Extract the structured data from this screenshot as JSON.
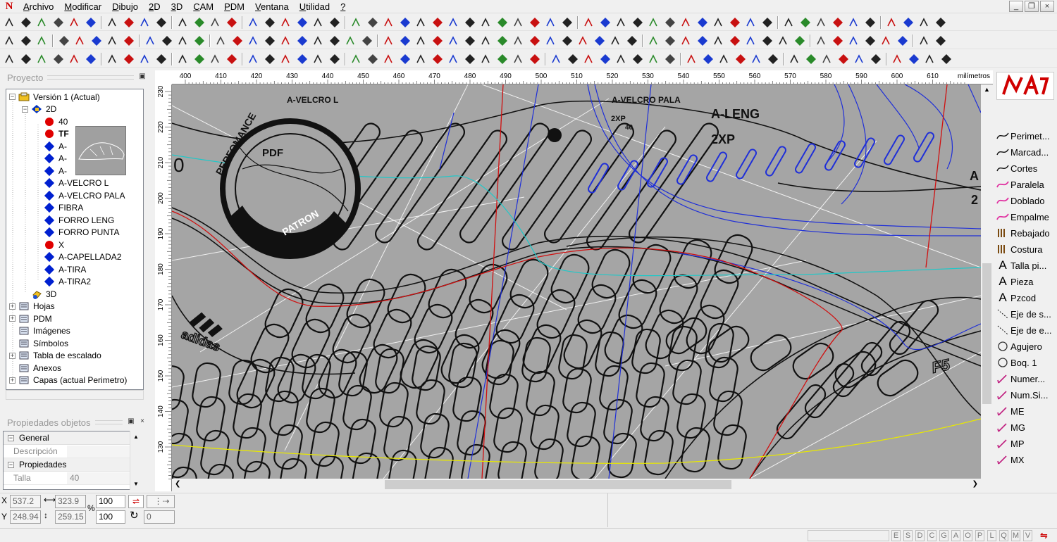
{
  "menu": [
    {
      "label": "Archivo",
      "first": "A",
      "rest": "rchivo"
    },
    {
      "label": "Modificar",
      "first": "M",
      "rest": "odificar"
    },
    {
      "label": "Dibujo",
      "first": "D",
      "rest": "ibujo"
    },
    {
      "label": "2D",
      "first": "2",
      "rest": "D"
    },
    {
      "label": "3D",
      "first": "3",
      "rest": "D"
    },
    {
      "label": "CAM",
      "first": "C",
      "rest": "AM"
    },
    {
      "label": "PDM",
      "first": "P",
      "rest": "DM"
    },
    {
      "label": "Ventana",
      "first": "V",
      "rest": "entana"
    },
    {
      "label": "Utilidad",
      "first": "U",
      "rest": "tilidad"
    },
    {
      "label": "?",
      "first": "?",
      "rest": ""
    }
  ],
  "project_panel": {
    "title": "Proyecto",
    "tree": [
      {
        "label": "Versión 1 (Actual)",
        "icon": "version-icon",
        "level": 0,
        "exp": "−"
      },
      {
        "label": "2D",
        "icon": "2d-icon",
        "level": 1,
        "exp": "−"
      },
      {
        "label": "40",
        "icon": "red-dot",
        "level": 2
      },
      {
        "label": "TF",
        "icon": "red-dot",
        "level": 2,
        "bold": true
      },
      {
        "label": "A-",
        "icon": "blue-diamond",
        "level": 2
      },
      {
        "label": "A-",
        "icon": "blue-diamond",
        "level": 2
      },
      {
        "label": "A-",
        "icon": "blue-diamond",
        "level": 2
      },
      {
        "label": "A-VELCRO L",
        "icon": "blue-diamond",
        "level": 2
      },
      {
        "label": "A-VELCRO PALA",
        "icon": "blue-diamond",
        "level": 2
      },
      {
        "label": "FIBRA",
        "icon": "blue-diamond",
        "level": 2
      },
      {
        "label": "FORRO LENG",
        "icon": "blue-diamond",
        "level": 2
      },
      {
        "label": "FORRO PUNTA",
        "icon": "blue-diamond",
        "level": 2
      },
      {
        "label": "X",
        "icon": "red-dot",
        "level": 2
      },
      {
        "label": "A-CAPELLADA2",
        "icon": "blue-diamond",
        "level": 2
      },
      {
        "label": "A-TIRA",
        "icon": "blue-diamond",
        "level": 2
      },
      {
        "label": "A-TIRA2",
        "icon": "blue-diamond",
        "level": 2
      },
      {
        "label": "3D",
        "icon": "3d-icon",
        "level": 1
      },
      {
        "label": "Hojas",
        "icon": "sheets-icon",
        "level": 0,
        "exp": "+"
      },
      {
        "label": "PDM",
        "icon": "pdm-icon",
        "level": 0,
        "exp": "+"
      },
      {
        "label": "Imágenes",
        "icon": "images-icon",
        "level": 0
      },
      {
        "label": "Símbolos",
        "icon": "symbols-icon",
        "level": 0
      },
      {
        "label": "Tabla de escalado",
        "icon": "table-icon",
        "level": 0,
        "exp": "+"
      },
      {
        "label": "Anexos",
        "icon": "attach-icon",
        "level": 0
      },
      {
        "label": "Capas (actual Perimetro)",
        "icon": "layers-icon",
        "level": 0,
        "exp": "+"
      }
    ]
  },
  "props_panel": {
    "title": "Propiedades objetos",
    "section_general": "General",
    "desc_label": "Descripción",
    "desc_value": "",
    "section_props": "Propiedades",
    "talla_label": "Talla",
    "talla_value": "40"
  },
  "ruler": {
    "top_labels": [
      "400",
      "410",
      "420",
      "430",
      "440",
      "450",
      "460",
      "470",
      "480",
      "490",
      "500",
      "510",
      "520",
      "530",
      "540",
      "550",
      "560",
      "570",
      "580",
      "590",
      "600",
      "610"
    ],
    "units": "milímetros",
    "left_labels": [
      "230",
      "220",
      "210",
      "200",
      "190",
      "180",
      "170",
      "160",
      "150",
      "140",
      "130"
    ]
  },
  "canvas_text": {
    "stamp_top": "PERFOMANCE",
    "stamp_mid": "PDF",
    "stamp_bottom": "PATRON",
    "brand": "adidas",
    "velcro_l": "A-VELCRO L",
    "velcro_pala": "A-VELCRO PALA",
    "a_leng": "A-LENG",
    "two_xp_big": "2XP",
    "two_xp_small": "2XP",
    "forty": "40",
    "zero": "0",
    "edge_a": "A",
    "edge_2": "2",
    "f5": "F5"
  },
  "tools": [
    {
      "label": "Perimet...",
      "icon": "curve-icon"
    },
    {
      "label": "Marcad...",
      "icon": "curve-icon"
    },
    {
      "label": "Cortes",
      "icon": "curve-icon"
    },
    {
      "label": "Paralela",
      "icon": "pink-wave-icon"
    },
    {
      "label": "Doblado",
      "icon": "pink-wave-icon"
    },
    {
      "label": "Empalme",
      "icon": "pink-wave-icon"
    },
    {
      "label": "Rebajado",
      "icon": "stitch-icon"
    },
    {
      "label": "Costura",
      "icon": "stitch-icon"
    },
    {
      "label": "Talla pi...",
      "icon": "text-a-icon"
    },
    {
      "label": "Pieza",
      "icon": "text-a-icon"
    },
    {
      "label": "Pzcod",
      "icon": "text-a-icon"
    },
    {
      "label": "Eje de s...",
      "icon": "axis-icon"
    },
    {
      "label": "Eje de e...",
      "icon": "axis-icon"
    },
    {
      "label": "Agujero",
      "icon": "circle-icon"
    },
    {
      "label": "Boq. 1",
      "icon": "circle-icon"
    },
    {
      "label": "Numer...",
      "icon": "pen-icon"
    },
    {
      "label": "Num.Si...",
      "icon": "pen-icon"
    },
    {
      "label": "ME",
      "icon": "pen-icon"
    },
    {
      "label": "MG",
      "icon": "pen-icon"
    },
    {
      "label": "MP",
      "icon": "pen-icon"
    },
    {
      "label": "MX",
      "icon": "pen-icon"
    }
  ],
  "coords": {
    "x_label": "X",
    "x_value": "537.2",
    "y_label": "Y",
    "y_value": "248.94",
    "dx_value": "323.9",
    "dy_value": "259.15",
    "percent": "%",
    "scale_x": "100",
    "scale_y": "100",
    "rotation": "0"
  },
  "status_letters": [
    "E",
    "S",
    "D",
    "C",
    "G",
    "A",
    "O",
    "P",
    "L",
    "Q",
    "M",
    "V"
  ],
  "colors": {
    "canvas_bg": "#a5a5a5",
    "pattern_line": "#111111",
    "blue_line": "#1f2fd8",
    "red_line": "#d01010",
    "cyan_line": "#20c8c8",
    "yellow_line": "#e8e800",
    "white_line": "#f4f4f4"
  }
}
